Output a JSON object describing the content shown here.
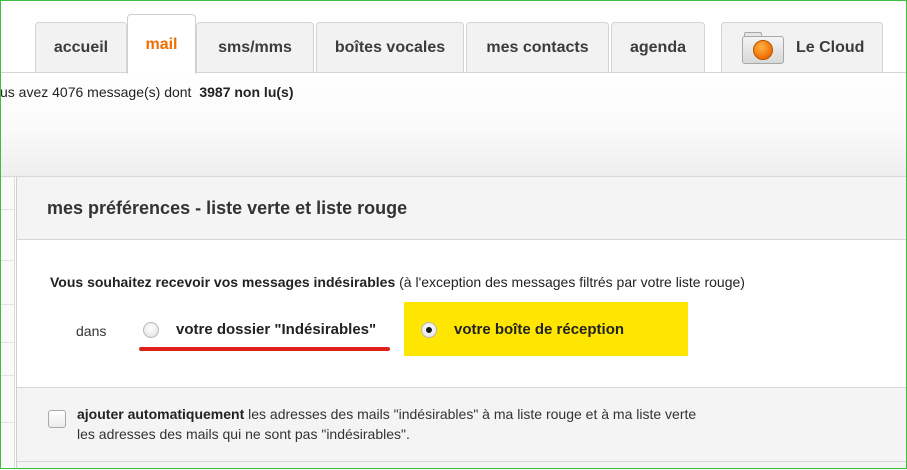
{
  "tabs": [
    {
      "label": "accueil"
    },
    {
      "label": "mail"
    },
    {
      "label": "sms/mms"
    },
    {
      "label": "boîtes vocales"
    },
    {
      "label": "mes contacts"
    },
    {
      "label": "agenda"
    },
    {
      "label": "Le Cloud"
    }
  ],
  "status": {
    "prefix": "us avez 4076 message(s) dont",
    "unread": "3987 non lu(s)"
  },
  "panel": {
    "title": "mes préférences - liste verte et liste rouge",
    "question_bold": "Vous souhaitez recevoir vos messages indésirables",
    "question_rest": " (à l'exception des messages filtrés par votre liste rouge)",
    "dans": "dans",
    "options": [
      {
        "label": "votre dossier \"Indésirables\"",
        "checked": false
      },
      {
        "label": "votre boîte de réception",
        "checked": true
      }
    ],
    "auto_bold": "ajouter automatiquement",
    "auto_rest": " les adresses des mails \"indésirables\" à ma liste rouge et à ma liste verte les adresses des mails qui ne sont pas \"indésirables\".",
    "auto_checked": false
  },
  "colors": {
    "accent": "#f16e00",
    "highlight": "#ffe600",
    "annotation": "#e0201b",
    "frame": "#3fbf3f"
  }
}
